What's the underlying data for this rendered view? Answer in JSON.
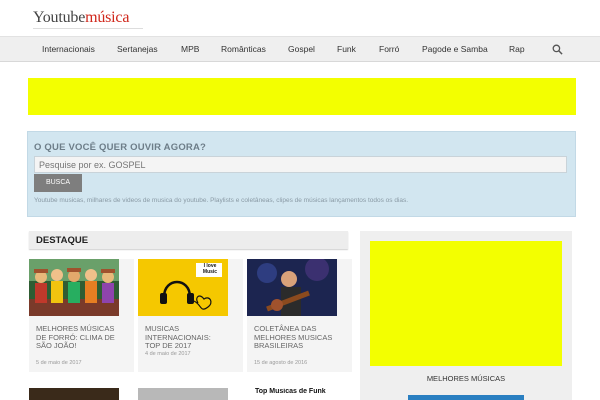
{
  "brand": {
    "part1": "Youtube",
    "part2": "música"
  },
  "nav": {
    "items": [
      "Internacionais",
      "Sertanejas",
      "MPB",
      "Românticas",
      "Gospel",
      "Funk",
      "Forró",
      "Pagode e Samba",
      "Rap"
    ]
  },
  "search": {
    "title": "O QUE VOCÊ QUER OUVIR AGORA?",
    "placeholder": "Pesquise por ex. GOSPEL",
    "button": "BUSCA",
    "description": "Youtube musicas, milhares de videos de musica do youtube. Playlists e coletâneas, clipes de músicas lançamentos todos os dias."
  },
  "featured": {
    "heading": "DESTAQUE",
    "cards": [
      {
        "title": "MELHORES MÚSICAS DE FORRÓ: CLIMA DE SÃO JOÃO!",
        "date": "5 de maio de 2017"
      },
      {
        "title": "MUSICAS INTERNACIONAIS: TOP DE 2017",
        "date": "4 de maio de 2017"
      },
      {
        "title": "COLETÂNEA DAS MELHORES MUSICAS BRASILEIRAS",
        "date": "15 de agosto de 2016"
      }
    ],
    "thumb2_text": "I love Music",
    "row2_card3_text": "Top Musicas de Funk"
  },
  "sidebar": {
    "label": "MELHORES MÚSICAS"
  },
  "colors": {
    "accent_red": "#d0271b",
    "ad_yellow": "#f3ff00",
    "search_bg": "#d2e6f0",
    "link_blue": "#2a7fc1"
  }
}
